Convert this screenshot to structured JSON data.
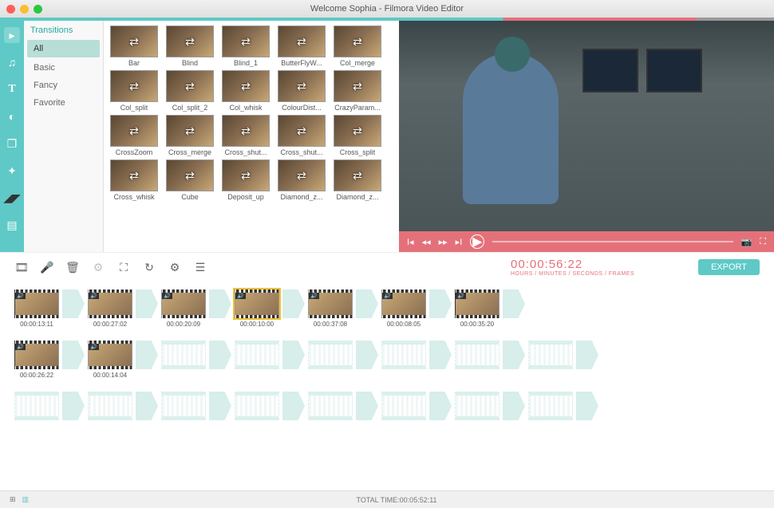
{
  "window": {
    "title": "Welcome Sophia - Filmora Video Editor"
  },
  "sidebar_tools": [
    "media",
    "music",
    "text",
    "filters",
    "overlays",
    "elements",
    "split",
    "transitions"
  ],
  "categories": {
    "header": "Transitions",
    "items": [
      "All",
      "Basic",
      "Fancy",
      "Favorite"
    ],
    "selected": "All"
  },
  "transitions": [
    "Bar",
    "Blind",
    "Blind_1",
    "ButterFlyW...",
    "Col_merge",
    "Col_split",
    "Col_split_2",
    "Col_whisk",
    "ColourDist...",
    "CrazyParam...",
    "CrossZoom",
    "Cross_merge",
    "Cross_shut...",
    "Cross_shut...",
    "Cross_split",
    "Cross_whisk",
    "Cube",
    "Deposit_up",
    "Diamond_z...",
    "Diamond_z..."
  ],
  "playback": {
    "timecode": "00:00:56:22",
    "tc_label": "HOURS / MINUTES / SECONDS / FRAMES"
  },
  "export_label": "EXPORT",
  "clips_row1": [
    {
      "ts": "00:00:13:11",
      "sel": false
    },
    {
      "t": true
    },
    {
      "ts": "00:00:27:02",
      "sel": false
    },
    {
      "t": true
    },
    {
      "ts": "00:00:20:09",
      "sel": false
    },
    {
      "t": true
    },
    {
      "ts": "00:00:10:00",
      "sel": true
    },
    {
      "t": true
    },
    {
      "ts": "00:00:37:08",
      "sel": false
    },
    {
      "t": true
    },
    {
      "ts": "00:00:08:05",
      "sel": false
    },
    {
      "t": true
    },
    {
      "ts": "00:00:35:20",
      "sel": false
    },
    {
      "t": true
    }
  ],
  "clips_row2": [
    {
      "ts": "00:00:26:22"
    },
    {
      "t": true
    },
    {
      "ts": "00:00:14:04"
    },
    {
      "t": true
    }
  ],
  "footer": {
    "total_label": "TOTAL TIME:",
    "total_time": "00:05:52:11"
  }
}
